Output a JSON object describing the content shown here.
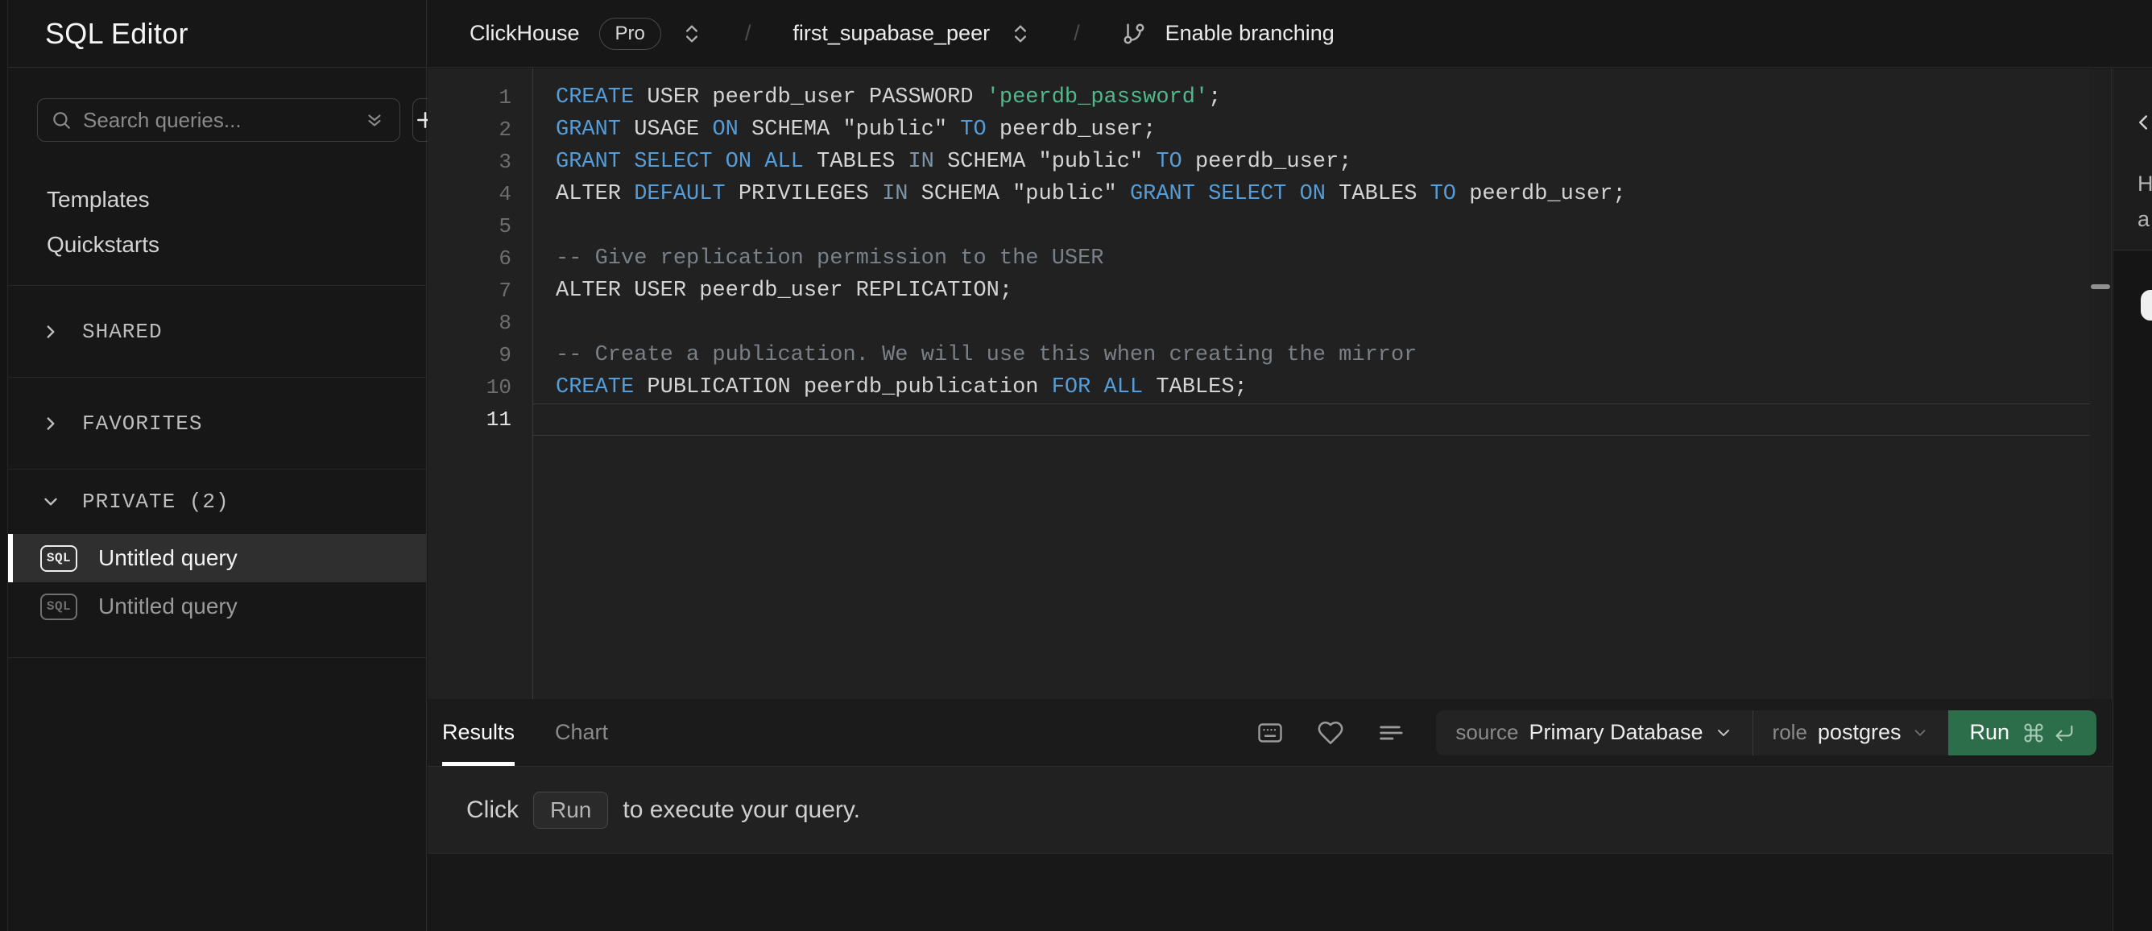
{
  "app": {
    "title": "SQL Editor"
  },
  "topbar": {
    "service_name": "ClickHouse",
    "service_badge": "Pro",
    "separator": "/",
    "connection_name": "first_supabase_peer",
    "branching_label": "Enable branching"
  },
  "sidebar": {
    "search": {
      "placeholder": "Search queries..."
    },
    "links": [
      {
        "label": "Templates"
      },
      {
        "label": "Quickstarts"
      }
    ],
    "sections": [
      {
        "label": "SHARED",
        "expanded": false
      },
      {
        "label": "FAVORITES",
        "expanded": false
      },
      {
        "label": "PRIVATE (2)",
        "expanded": true
      }
    ],
    "queries": [
      {
        "label": "Untitled query",
        "badge": "SQL",
        "selected": true
      },
      {
        "label": "Untitled query",
        "badge": "SQL",
        "selected": false
      }
    ]
  },
  "editor": {
    "active_line": 11,
    "lines": [
      {
        "n": 1,
        "tokens": [
          [
            "kw",
            "CREATE"
          ],
          [
            "plain",
            " USER peerdb_user PASSWORD "
          ],
          [
            "str",
            "'peerdb_password'"
          ],
          [
            "plain",
            ";"
          ]
        ]
      },
      {
        "n": 2,
        "tokens": [
          [
            "kw",
            "GRANT"
          ],
          [
            "plain",
            " USAGE "
          ],
          [
            "kw",
            "ON"
          ],
          [
            "plain",
            " SCHEMA \"public\" "
          ],
          [
            "kw",
            "TO"
          ],
          [
            "plain",
            " peerdb_user;"
          ]
        ]
      },
      {
        "n": 3,
        "tokens": [
          [
            "kw",
            "GRANT"
          ],
          [
            "plain",
            " "
          ],
          [
            "kw",
            "SELECT"
          ],
          [
            "plain",
            " "
          ],
          [
            "kw",
            "ON"
          ],
          [
            "plain",
            " "
          ],
          [
            "kw",
            "ALL"
          ],
          [
            "plain",
            " TABLES "
          ],
          [
            "kw2",
            "IN"
          ],
          [
            "plain",
            " SCHEMA \"public\" "
          ],
          [
            "kw",
            "TO"
          ],
          [
            "plain",
            " peerdb_user;"
          ]
        ]
      },
      {
        "n": 4,
        "tokens": [
          [
            "plain",
            "ALTER "
          ],
          [
            "kw",
            "DEFAULT"
          ],
          [
            "plain",
            " PRIVILEGES "
          ],
          [
            "kw2",
            "IN"
          ],
          [
            "plain",
            " SCHEMA \"public\" "
          ],
          [
            "kw",
            "GRANT"
          ],
          [
            "plain",
            " "
          ],
          [
            "kw",
            "SELECT"
          ],
          [
            "plain",
            " "
          ],
          [
            "kw",
            "ON"
          ],
          [
            "plain",
            " TABLES "
          ],
          [
            "kw",
            "TO"
          ],
          [
            "plain",
            " peerdb_user;"
          ]
        ]
      },
      {
        "n": 5,
        "tokens": []
      },
      {
        "n": 6,
        "tokens": [
          [
            "comment",
            "-- Give replication permission to the USER"
          ]
        ]
      },
      {
        "n": 7,
        "tokens": [
          [
            "plain",
            "ALTER USER peerdb_user REPLICATION;"
          ]
        ]
      },
      {
        "n": 8,
        "tokens": []
      },
      {
        "n": 9,
        "tokens": [
          [
            "comment",
            "-- Create a publication. We will use this when creating the mirror"
          ]
        ]
      },
      {
        "n": 10,
        "tokens": [
          [
            "kw",
            "CREATE"
          ],
          [
            "plain",
            " PUBLICATION peerdb_publication "
          ],
          [
            "kw",
            "FOR"
          ],
          [
            "plain",
            " "
          ],
          [
            "kw",
            "ALL"
          ],
          [
            "plain",
            " TABLES;"
          ]
        ]
      },
      {
        "n": 11,
        "tokens": []
      }
    ]
  },
  "results": {
    "tabs": [
      {
        "label": "Results",
        "active": true
      },
      {
        "label": "Chart",
        "active": false
      }
    ],
    "source_label": "source",
    "source_value": "Primary Database",
    "role_label": "role",
    "role_value": "postgres",
    "run_label": "Run",
    "message": {
      "prefix": "Click",
      "key": "Run",
      "suffix": "to execute your query."
    }
  },
  "right_panel": {
    "truncated_text": [
      "H",
      "a"
    ]
  },
  "colors": {
    "keyword": "#569cd6",
    "keyword_dim": "#7d93a8",
    "string": "#4fb98c",
    "comment": "#7a8086",
    "run_green": "#2c6e49",
    "selected_row": "#2f2f2f",
    "background": "#171717",
    "editor_background": "#212121"
  }
}
